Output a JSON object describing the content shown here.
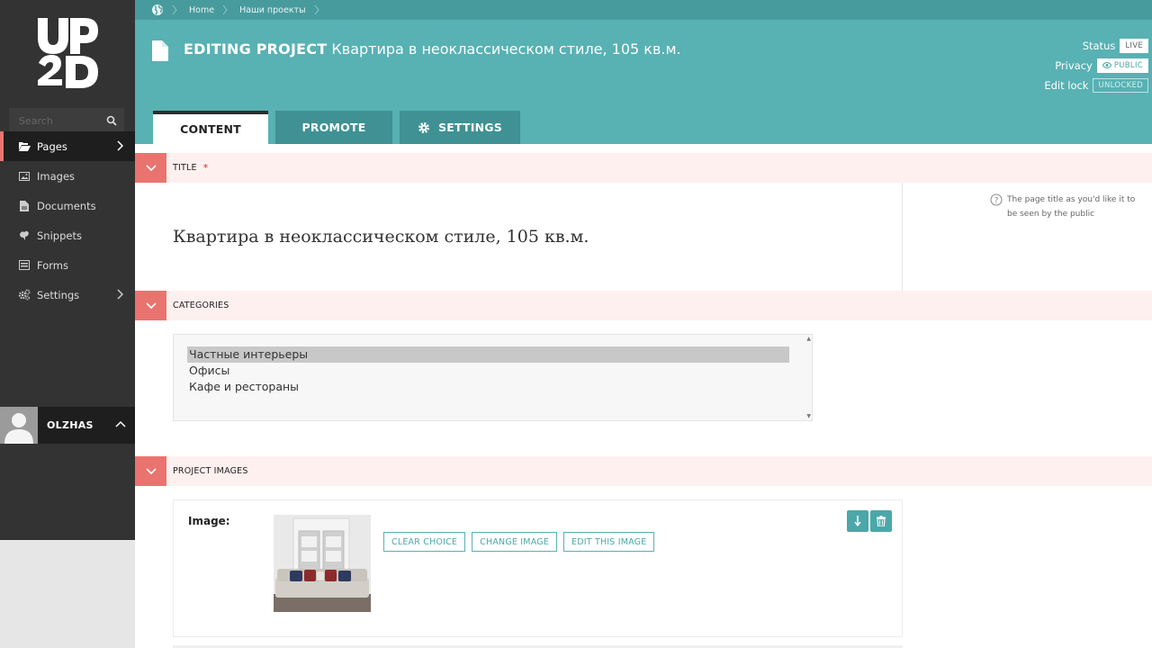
{
  "sidebar": {
    "logo_text": "UP2D",
    "search": {
      "placeholder": "Search"
    },
    "items": [
      {
        "label": "Pages",
        "icon": "folder-open-icon",
        "active": true,
        "has_submenu": true
      },
      {
        "label": "Images",
        "icon": "image-icon",
        "active": false,
        "has_submenu": false
      },
      {
        "label": "Documents",
        "icon": "document-icon",
        "active": false,
        "has_submenu": false
      },
      {
        "label": "Snippets",
        "icon": "snippet-icon",
        "active": false,
        "has_submenu": false
      },
      {
        "label": "Forms",
        "icon": "form-icon",
        "active": false,
        "has_submenu": false
      },
      {
        "label": "Settings",
        "icon": "cogs-icon",
        "active": false,
        "has_submenu": true
      }
    ],
    "user": {
      "name": "OLZHAS"
    }
  },
  "breadcrumb": {
    "items": [
      "Home",
      "Наши проекты"
    ]
  },
  "header": {
    "editing_label": "EDITING PROJECT",
    "page_title": "Квартира в неоклассическом стиле, 105 кв.м.",
    "status": {
      "label": "Status",
      "value": "LIVE"
    },
    "privacy": {
      "label": "Privacy",
      "value": "PUBLIC"
    },
    "edit_lock": {
      "label": "Edit lock",
      "value": "UNLOCKED"
    }
  },
  "tabs": [
    {
      "label": "CONTENT",
      "active": true
    },
    {
      "label": "PROMOTE",
      "active": false
    },
    {
      "label": "SETTINGS",
      "active": false
    }
  ],
  "sections": {
    "title": {
      "label": "TITLE",
      "required_mark": "*",
      "value": "Квартира в неоклассическом стиле, 105 кв.м.",
      "help": "The page title as you'd like it to be seen by the public"
    },
    "categories": {
      "label": "CATEGORIES",
      "options": [
        {
          "label": "Частные интерьеры",
          "selected": true
        },
        {
          "label": "Офисы",
          "selected": false
        },
        {
          "label": "Кафе и рестораны",
          "selected": false
        }
      ]
    },
    "project_images": {
      "label": "PROJECT IMAGES",
      "image_label": "Image:",
      "buttons": [
        "CLEAR CHOICE",
        "CHANGE IMAGE",
        "EDIT THIS IMAGE"
      ]
    }
  },
  "colors": {
    "teal": "#58b1b3",
    "teal_dark": "#479b9d",
    "coral": "#e9746f",
    "section_bg": "#fdf0ef",
    "sidebar_bg": "#333333"
  }
}
